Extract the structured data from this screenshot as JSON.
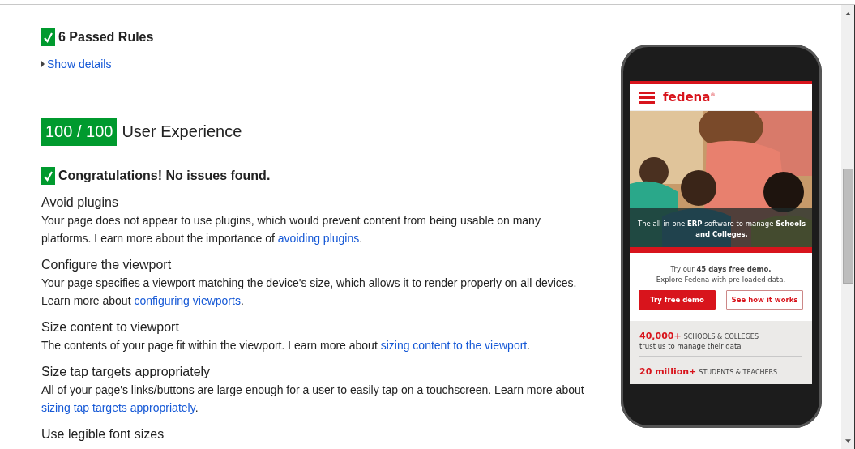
{
  "passed": {
    "title": "6 Passed Rules",
    "toggle": {
      "label": "Show details",
      "expanded": false
    }
  },
  "section": {
    "score": "100 / 100",
    "title": "User Experience",
    "status": "Congratulations! No issues found."
  },
  "rules": [
    {
      "title": "Avoid plugins",
      "description": [
        {
          "text": "Your page does not appear to use plugins, which would prevent content from being usable on many platforms. Learn more about the importance of "
        },
        {
          "link": "avoiding plugins"
        },
        {
          "text": "."
        }
      ]
    },
    {
      "title": "Configure the viewport",
      "description": [
        {
          "text": "Your page specifies a viewport matching the device's size, which allows it to render properly on all devices. Learn more about "
        },
        {
          "link": "configuring viewports"
        },
        {
          "text": "."
        }
      ]
    },
    {
      "title": "Size content to viewport",
      "description": [
        {
          "text": "The contents of your page fit within the viewport. Learn more about "
        },
        {
          "link": "sizing content to the viewport"
        },
        {
          "text": "."
        }
      ]
    },
    {
      "title": "Size tap targets appropriately",
      "description": [
        {
          "text": "All of your page's links/buttons are large enough for a user to easily tap on a touchscreen. Learn more about "
        },
        {
          "link": "sizing tap targets appropriately"
        },
        {
          "text": "."
        }
      ]
    },
    {
      "title": "Use legible font sizes"
    }
  ],
  "preview": {
    "logo": "fedena",
    "logo_mark": "®",
    "hero": {
      "kind": "picture",
      "caption": "The all-in-one **ERP** software to manage **Schools and Colleges.**"
    },
    "demo_lines": [
      "Try our **45 days free demo.**",
      "Explore Fedena with pre-loaded data."
    ],
    "buttons": [
      {
        "label": "Try free demo",
        "kind": "primary"
      },
      {
        "label": "See how it works",
        "kind": "outline"
      }
    ],
    "stats": [
      {
        "number": "40,000+",
        "label": "SCHOOLS & COLLEGES",
        "note": "trust us to manage their data"
      },
      {
        "number": "20 million+",
        "label": "STUDENTS & TEACHERS"
      }
    ]
  }
}
